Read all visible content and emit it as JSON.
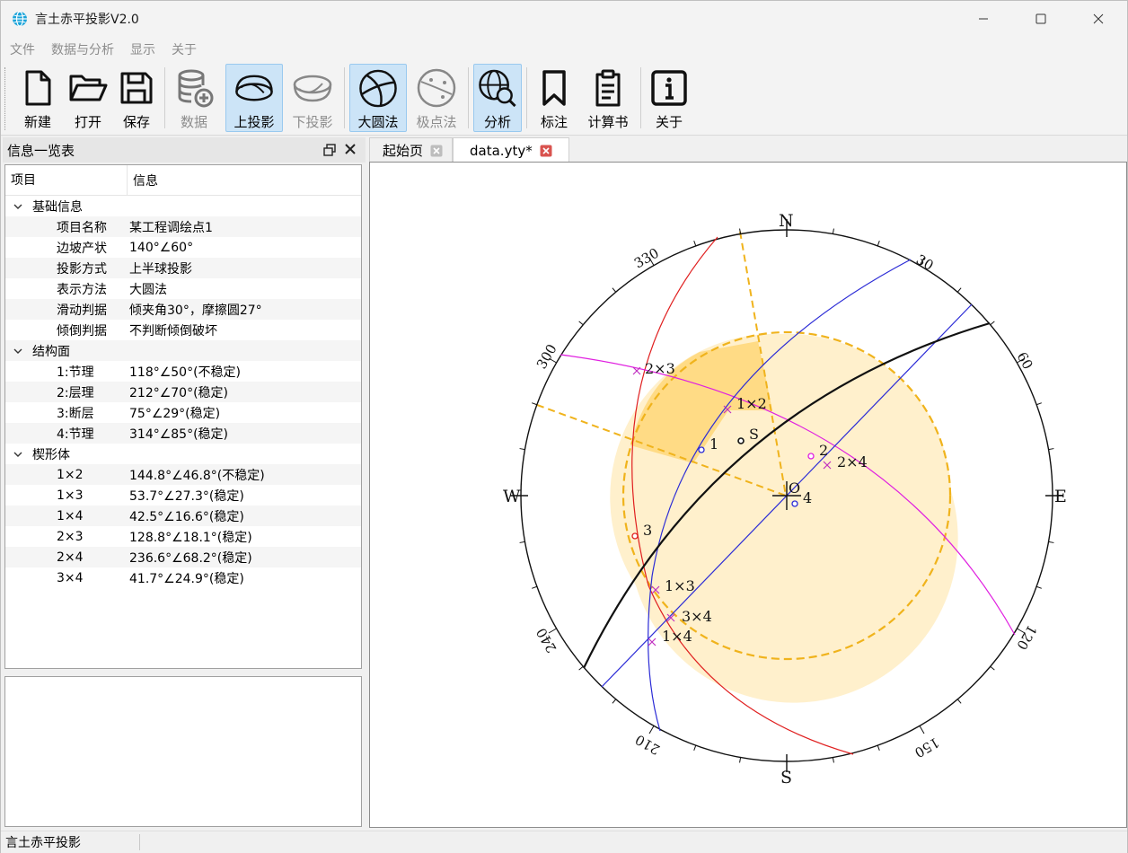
{
  "window": {
    "title": "言土赤平投影V2.0"
  },
  "menu": [
    "文件",
    "数据与分析",
    "显示",
    "关于"
  ],
  "toolbar": {
    "new": "新建",
    "open": "打开",
    "save": "保存",
    "data": "数据",
    "upper": "上投影",
    "lower": "下投影",
    "great_circle": "大圆法",
    "pole": "极点法",
    "analysis": "分析",
    "mark": "标注",
    "calc_book": "计算书",
    "about": "关于"
  },
  "dock": {
    "title": "信息一览表",
    "col_item": "项目",
    "col_info": "信息",
    "groups": [
      {
        "label": "基础信息",
        "rows": [
          {
            "k": "项目名称",
            "v": "某工程调绘点1"
          },
          {
            "k": "边坡产状",
            "v": "140°∠60°"
          },
          {
            "k": "投影方式",
            "v": "上半球投影"
          },
          {
            "k": "表示方法",
            "v": "大圆法"
          },
          {
            "k": "滑动判据",
            "v": "倾夹角30°，摩擦圆27°"
          },
          {
            "k": "倾倒判据",
            "v": "不判断倾倒破坏"
          }
        ]
      },
      {
        "label": "结构面",
        "rows": [
          {
            "k": "1:节理",
            "v": "118°∠50°(不稳定)"
          },
          {
            "k": "2:层理",
            "v": "212°∠70°(稳定)"
          },
          {
            "k": "3:断层",
            "v": "75°∠29°(稳定)"
          },
          {
            "k": "4:节理",
            "v": "314°∠85°(稳定)"
          }
        ]
      },
      {
        "label": "楔形体",
        "rows": [
          {
            "k": "1×2",
            "v": "144.8°∠46.8°(不稳定)"
          },
          {
            "k": "1×3",
            "v": "53.7°∠27.3°(稳定)"
          },
          {
            "k": "1×4",
            "v": "42.5°∠16.6°(稳定)"
          },
          {
            "k": "2×3",
            "v": "128.8°∠18.1°(稳定)"
          },
          {
            "k": "2×4",
            "v": "236.6°∠68.2°(稳定)"
          },
          {
            "k": "3×4",
            "v": "41.7°∠24.9°(稳定)"
          }
        ]
      }
    ]
  },
  "tabs": [
    {
      "label": "起始页"
    },
    {
      "label": "data.yty*"
    }
  ],
  "stereonet": {
    "compass": {
      "N": "N",
      "E": "E",
      "S": "S",
      "W": "W"
    },
    "azimuth_labels": [
      "30",
      "60",
      "120",
      "150",
      "210",
      "240",
      "300",
      "330"
    ],
    "center_label": "O",
    "slope_label": "S",
    "plane_labels": [
      "1",
      "2",
      "3",
      "4"
    ],
    "intersection_labels": [
      "1×2",
      "1×3",
      "1×4",
      "2×3",
      "2×4",
      "3×4"
    ],
    "colors": {
      "plane1": "#2b2bd6",
      "plane2": "#e020e0",
      "plane3": "#e02020",
      "plane4": "#2b2bd6",
      "slope": "#000000",
      "friction": "#f0b31c",
      "fill": "#ffd980"
    }
  },
  "status": {
    "text": "言土赤平投影"
  }
}
